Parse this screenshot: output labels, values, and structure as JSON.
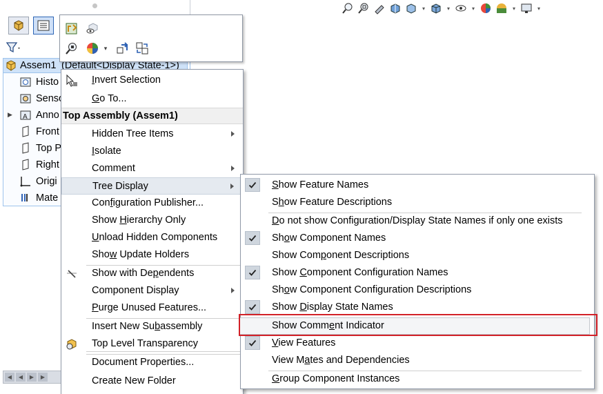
{
  "tree": {
    "root_label": "Assem1",
    "root_config": "(Default<Display State-1>)",
    "items": [
      {
        "label": "Histo",
        "icon": "history-folder-icon"
      },
      {
        "label": "Senso",
        "icon": "sensors-folder-icon"
      },
      {
        "label": "Anno",
        "icon": "annotations-folder-icon"
      },
      {
        "label": "Front",
        "icon": "plane-icon"
      },
      {
        "label": "Top P",
        "icon": "plane-icon"
      },
      {
        "label": "Right",
        "icon": "plane-icon"
      },
      {
        "label": "Origi",
        "icon": "origin-icon"
      },
      {
        "label": "Mate",
        "icon": "mates-folder-icon"
      }
    ]
  },
  "context_menu": {
    "items_top": [
      {
        "label": "Invert Selection",
        "ul": "I"
      },
      {
        "label": "Go To...",
        "ul": "G"
      }
    ],
    "header": "Top Assembly (Assem1)",
    "items": [
      {
        "label": "Hidden Tree Items",
        "submenu": true
      },
      {
        "label": "Isolate",
        "ul": "I"
      },
      {
        "label": "Comment",
        "submenu": true
      },
      {
        "label": "Tree Display",
        "submenu": true,
        "hot": true
      },
      {
        "label": "Configuration Publisher...",
        "ul": "f"
      },
      {
        "label": "Show Hierarchy Only",
        "ul": "H"
      },
      {
        "label": "Unload Hidden Components",
        "ul": "U"
      },
      {
        "label": "Show Update Holders",
        "ul": "w"
      },
      {
        "label": "Show with Dependents",
        "ul": "p"
      },
      {
        "label": "Component Display",
        "submenu": true
      },
      {
        "label": "Purge Unused Features...",
        "ul": "P"
      },
      {
        "label": "Insert New Subassembly",
        "ul": "b"
      },
      {
        "label": "Top Level Transparency"
      },
      {
        "label": "Document Properties..."
      },
      {
        "label": "Create New Folder"
      }
    ]
  },
  "tree_display_submenu": {
    "items": [
      {
        "label": "Show Feature Names",
        "checked": true,
        "ul": "S"
      },
      {
        "label": "Show Feature Descriptions",
        "checked": false,
        "ul": "h"
      },
      {
        "label": "Do not show Configuration/Display State Names if only one exists",
        "checked": false,
        "ul": "D"
      },
      {
        "label": "Show Component Names",
        "checked": true,
        "ul": "o"
      },
      {
        "label": "Show Component Descriptions",
        "checked": false,
        "ul": "p"
      },
      {
        "label": "Show Component Configuration Names",
        "checked": true,
        "ul": "C"
      },
      {
        "label": "Show Component Configuration Descriptions",
        "checked": false,
        "ul": "o"
      },
      {
        "label": "Show Display State Names",
        "checked": true,
        "ul": "D"
      },
      {
        "label": "Show Comment Indicator",
        "checked": false,
        "ul": "e",
        "highlighted": true
      },
      {
        "label": "View Features",
        "checked": true,
        "ul": "V"
      },
      {
        "label": "View Mates and Dependencies",
        "checked": false,
        "ul": "a"
      },
      {
        "label": "Group Component Instances",
        "checked": false,
        "ul": "G"
      }
    ]
  },
  "colors": {
    "highlight_box": "#d22027",
    "selection": "#cfe2f8",
    "check_bg": "#cfd6de"
  }
}
